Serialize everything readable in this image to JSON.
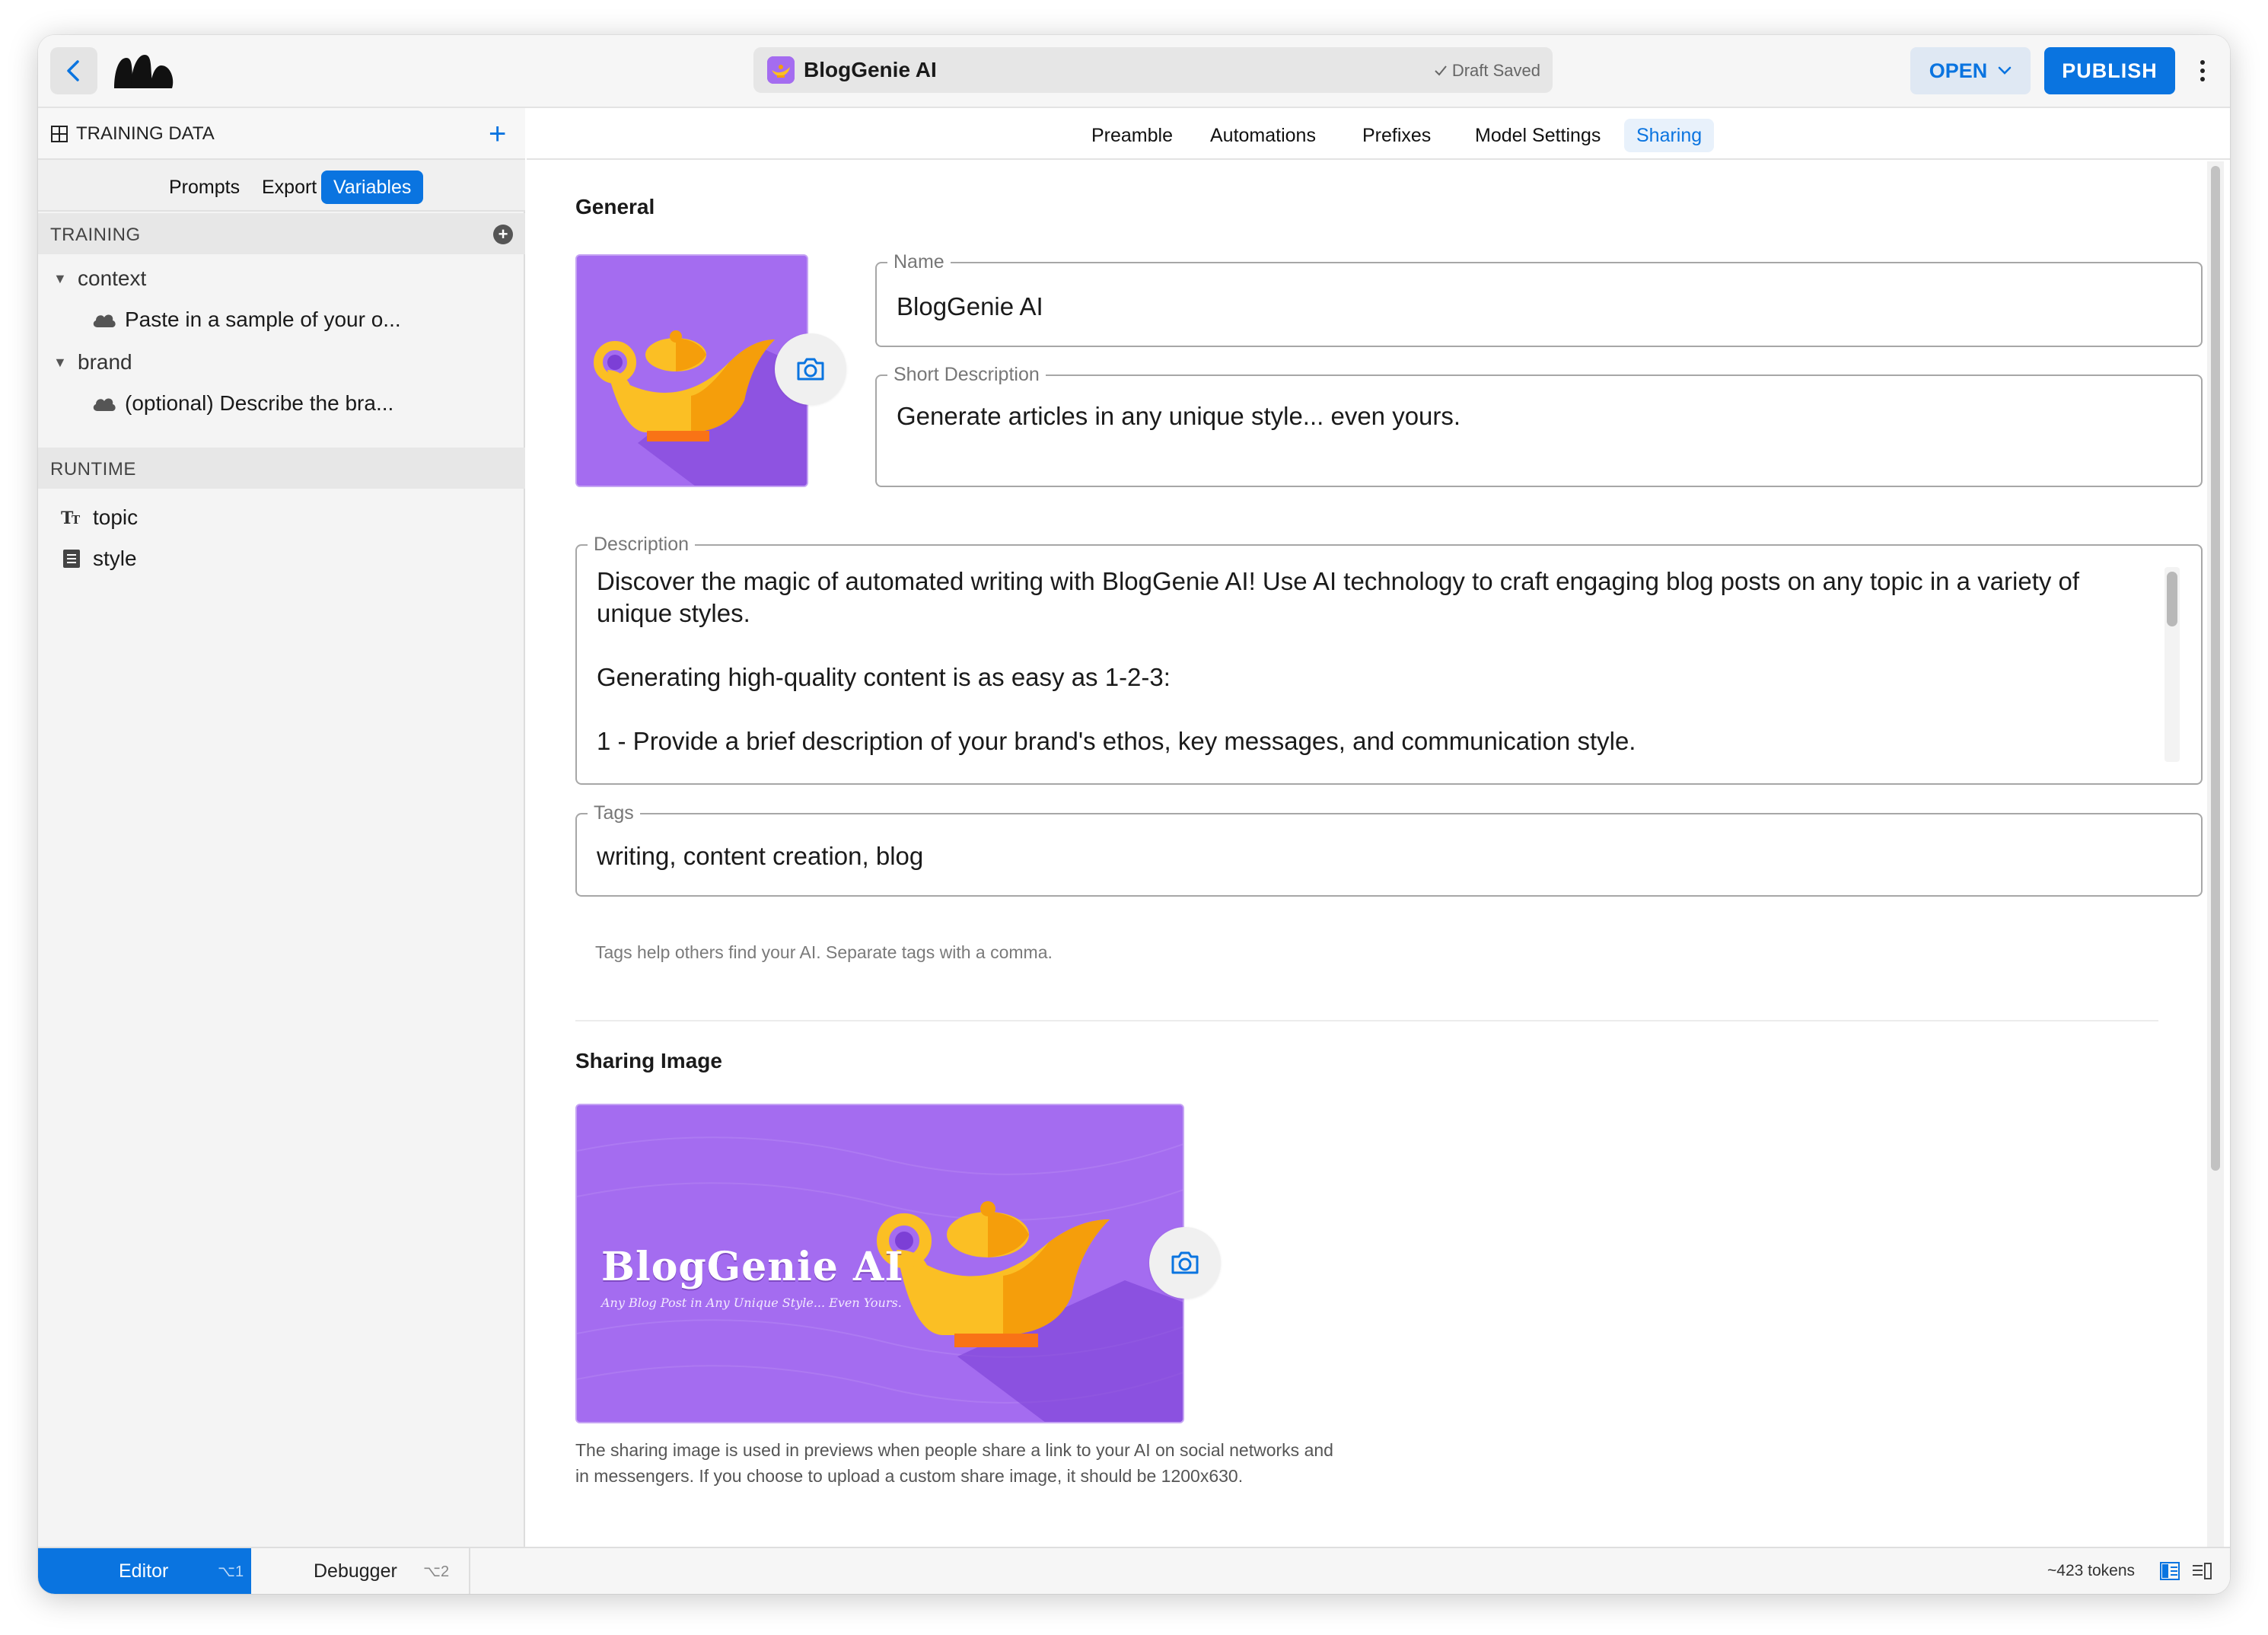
{
  "topbar": {
    "app_title": "BlogGenie AI",
    "draft_status": "Draft Saved",
    "open_label": "OPEN",
    "publish_label": "PUBLISH"
  },
  "sidebar": {
    "header_label": "TRAINING DATA",
    "tabs": [
      "Prompts",
      "Export",
      "Variables"
    ],
    "active_tab": "Variables",
    "training_label": "TRAINING",
    "training_items": [
      {
        "name": "context",
        "child": "Paste in a sample of your o..."
      },
      {
        "name": "brand",
        "child": "(optional) Describe the bra..."
      }
    ],
    "runtime_label": "RUNTIME",
    "runtime_items": [
      {
        "name": "topic",
        "icon": "text-type-icon"
      },
      {
        "name": "style",
        "icon": "list-doc-icon"
      }
    ]
  },
  "main": {
    "tabs": [
      "Preamble",
      "Automations",
      "Prefixes",
      "Model Settings",
      "Sharing"
    ],
    "active_tab": "Sharing",
    "general_heading": "General",
    "name_label": "Name",
    "name_value": "BlogGenie AI",
    "short_desc_label": "Short Description",
    "short_desc_value": "Generate articles in any unique style... even yours.",
    "description_label": "Description",
    "description_paragraphs": [
      "Discover the magic of automated writing with BlogGenie AI! Use AI technology to craft engaging blog posts on any topic in a variety of unique styles.",
      "Generating high-quality content is as easy as 1-2-3:",
      "1 - Provide a brief description of your brand's ethos, key messages, and communication style."
    ],
    "tags_label": "Tags",
    "tags_value": "writing, content creation, blog",
    "tags_helper": "Tags help others find your AI. Separate tags with a comma.",
    "sharing_heading": "Sharing Image",
    "share_image_title": "BlogGenie AI",
    "share_image_subtitle": "Any Blog Post in Any Unique Style... Even Yours.",
    "sharing_caption": "The sharing image is used in previews when people share a link to your AI on social networks and in messengers. If you choose to upload a custom share image, it should be 1200x630."
  },
  "bottombar": {
    "editor_label": "Editor",
    "editor_shortcut": "⌥1",
    "debugger_label": "Debugger",
    "debugger_shortcut": "⌥2",
    "tokens": "~423 tokens"
  },
  "colors": {
    "accent": "#0a74e0",
    "image_purple": "#a46cf0",
    "lamp_gold": "#fbbf24",
    "lamp_orange": "#f59e0b"
  }
}
